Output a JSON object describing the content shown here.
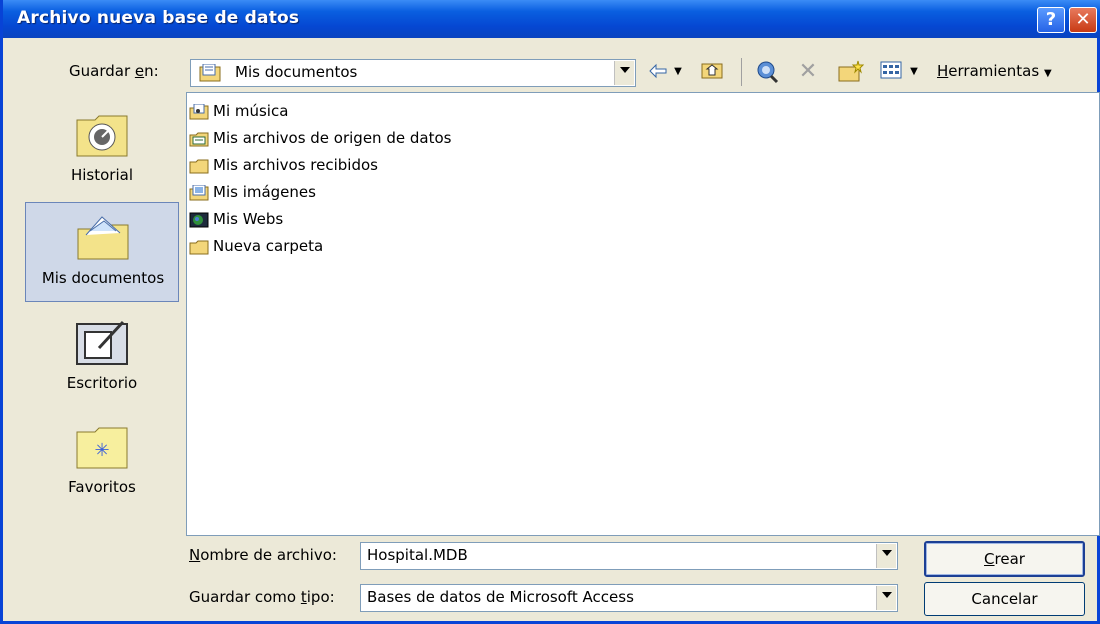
{
  "window": {
    "title": "Archivo nueva base de datos",
    "help_label": "?",
    "close_label": "✕"
  },
  "toolbar": {
    "save_in_label_prefix": "Guardar ",
    "save_in_label_accel": "e",
    "save_in_label_suffix": "n:",
    "location": "Mis documentos",
    "tools_label_accel": "H",
    "tools_label_rest": "erramientas",
    "icons": [
      "back-arrow-icon",
      "dropdown-arrow-icon",
      "up-folder-icon",
      "search-web-icon",
      "delete-icon",
      "new-folder-icon",
      "views-icon",
      "dropdown-arrow-icon"
    ]
  },
  "places": [
    {
      "label": "Historial",
      "icon": "history-icon",
      "selected": false
    },
    {
      "label": "Mis documentos",
      "icon": "my-documents-icon",
      "selected": true
    },
    {
      "label": "Escritorio",
      "icon": "desktop-icon",
      "selected": false
    },
    {
      "label": "Favoritos",
      "icon": "favorites-icon",
      "selected": false
    }
  ],
  "files": [
    {
      "name": "Mi música",
      "icon": "music-folder-icon"
    },
    {
      "name": "Mis archivos de origen de datos",
      "icon": "data-source-folder-icon"
    },
    {
      "name": "Mis archivos recibidos",
      "icon": "folder-icon"
    },
    {
      "name": "Mis imágenes",
      "icon": "pictures-folder-icon"
    },
    {
      "name": "Mis Webs",
      "icon": "web-folder-icon"
    },
    {
      "name": "Nueva carpeta",
      "icon": "folder-icon"
    }
  ],
  "form": {
    "filename_label_accel": "N",
    "filename_label_rest": "ombre de archivo:",
    "filename_value": "Hospital.MDB",
    "type_label_prefix": "Guardar como ",
    "type_label_accel": "t",
    "type_label_suffix": "ipo:",
    "type_value": "Bases de datos de Microsoft Access"
  },
  "buttons": {
    "create_accel": "C",
    "create_rest": "rear",
    "cancel": "Cancelar"
  },
  "colors": {
    "titlebar": "#0a5fe0",
    "dialog_bg": "#ece9d8",
    "selected_place": "#cfd8e8"
  }
}
